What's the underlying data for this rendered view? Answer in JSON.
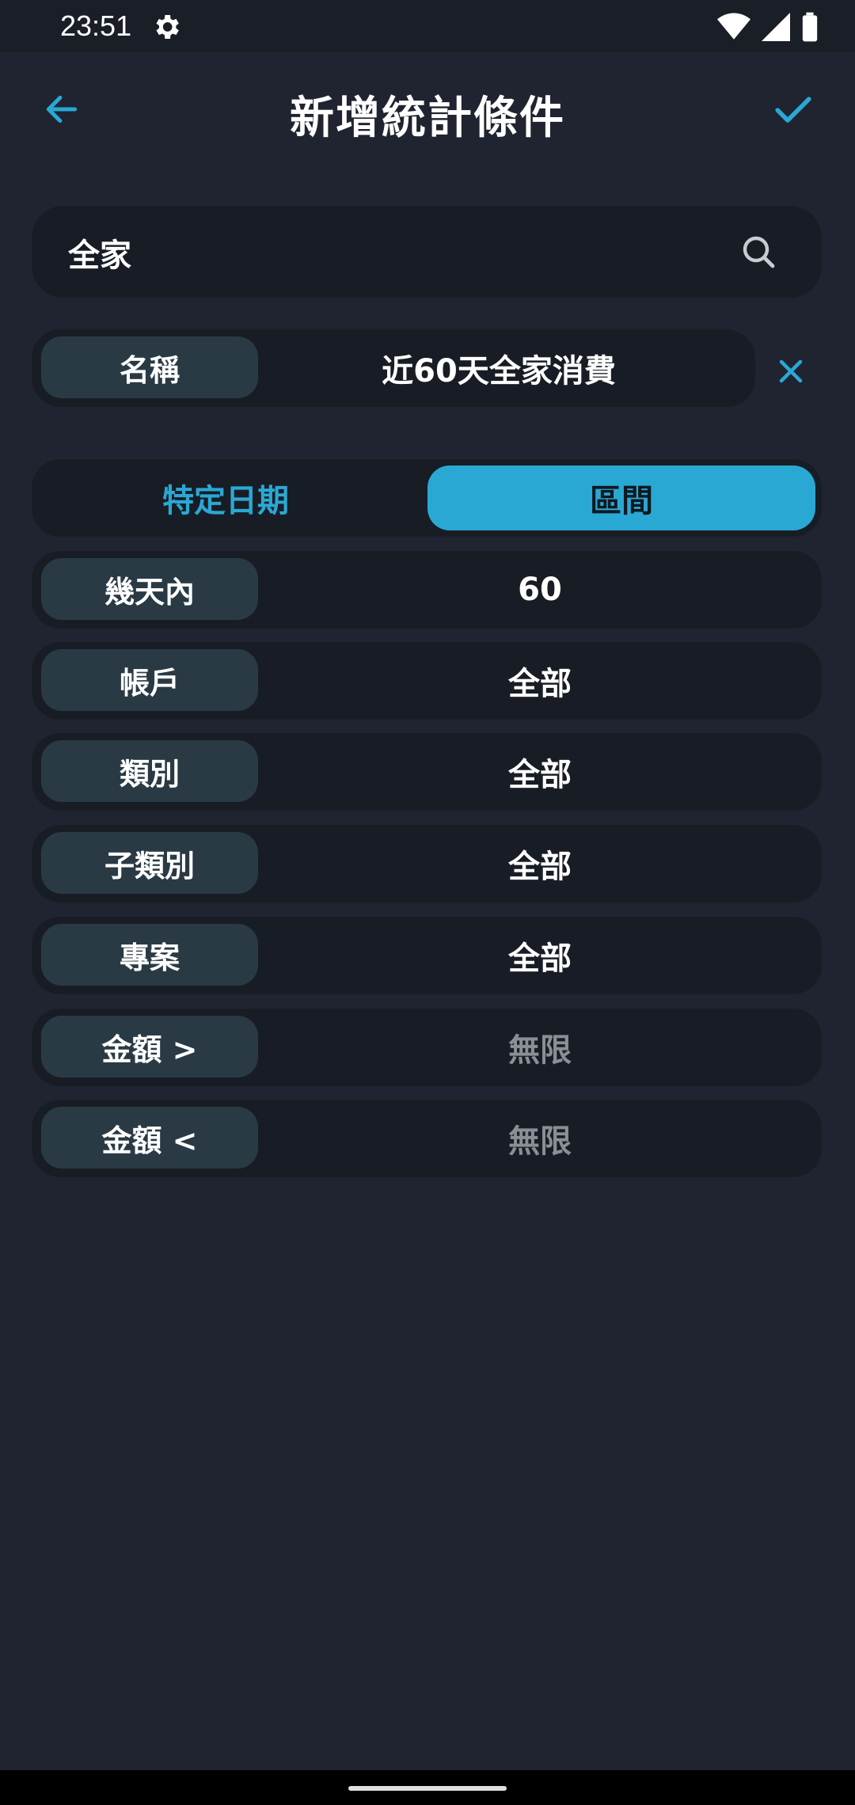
{
  "status_bar": {
    "time": "23:51"
  },
  "header": {
    "title": "新增統計條件"
  },
  "search": {
    "value": "全家"
  },
  "name_field": {
    "label": "名稱",
    "value": "近60天全家消費"
  },
  "segment": {
    "options": [
      "特定日期",
      "區間"
    ],
    "selected": "區間"
  },
  "rows": [
    {
      "label": "幾天內",
      "value": "60"
    },
    {
      "label": "帳戶",
      "value": "全部"
    },
    {
      "label": "類別",
      "value": "全部"
    },
    {
      "label": "子類別",
      "value": "全部"
    },
    {
      "label": "專案",
      "value": "全部"
    },
    {
      "label": "金額 >",
      "value": "無限"
    },
    {
      "label": "金額 <",
      "value": "無限"
    }
  ],
  "colors": {
    "accent": "#2aa8d4",
    "background": "#1f2430",
    "field": "#181d25",
    "pill": "#2a3a45",
    "muted": "#8a8f96"
  }
}
